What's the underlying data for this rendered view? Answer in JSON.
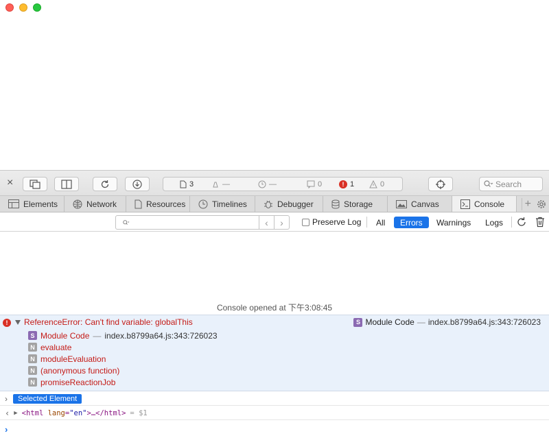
{
  "toolbar": {
    "resource_count": "3",
    "load_time": "—",
    "timeline": "—",
    "log_count": "0",
    "error_count": "1",
    "warning_count": "0",
    "search_label": "Search"
  },
  "tabs": [
    {
      "label": "Elements"
    },
    {
      "label": "Network"
    },
    {
      "label": "Resources"
    },
    {
      "label": "Timelines"
    },
    {
      "label": "Debugger"
    },
    {
      "label": "Storage"
    },
    {
      "label": "Canvas"
    },
    {
      "label": "Console",
      "active": true
    }
  ],
  "filterbar": {
    "preserve_log": "Preserve Log",
    "levels": [
      "All",
      "Errors",
      "Warnings",
      "Logs"
    ],
    "selected_level": "Errors"
  },
  "console": {
    "opened_text": "Console opened at 下午3:08:45",
    "error": {
      "message": "ReferenceError: Can't find variable: globalThis",
      "location_name": "Module Code",
      "location_sep": "—",
      "location_file": "index.b8799a64.js:343:726023",
      "frames": [
        {
          "badge": "S",
          "name": "Module Code",
          "sep": "—",
          "loc": "index.b8799a64.js:343:726023"
        },
        {
          "badge": "N",
          "name": "evaluate"
        },
        {
          "badge": "N",
          "name": "moduleEvaluation"
        },
        {
          "badge": "N",
          "name": "(anonymous function)"
        },
        {
          "badge": "N",
          "name": "promiseReactionJob"
        }
      ]
    },
    "selected_element_label": "Selected Element",
    "html_open": "<html",
    "html_attr": "lang",
    "html_eq": "=",
    "html_val": "\"en\"",
    "html_rest": ">…</html>",
    "html_ref": "= $1"
  },
  "colors": {
    "accent": "#1a73e8",
    "error": "#d93025",
    "error_text": "#c41a16",
    "error_bg": "#e9f1fb"
  }
}
